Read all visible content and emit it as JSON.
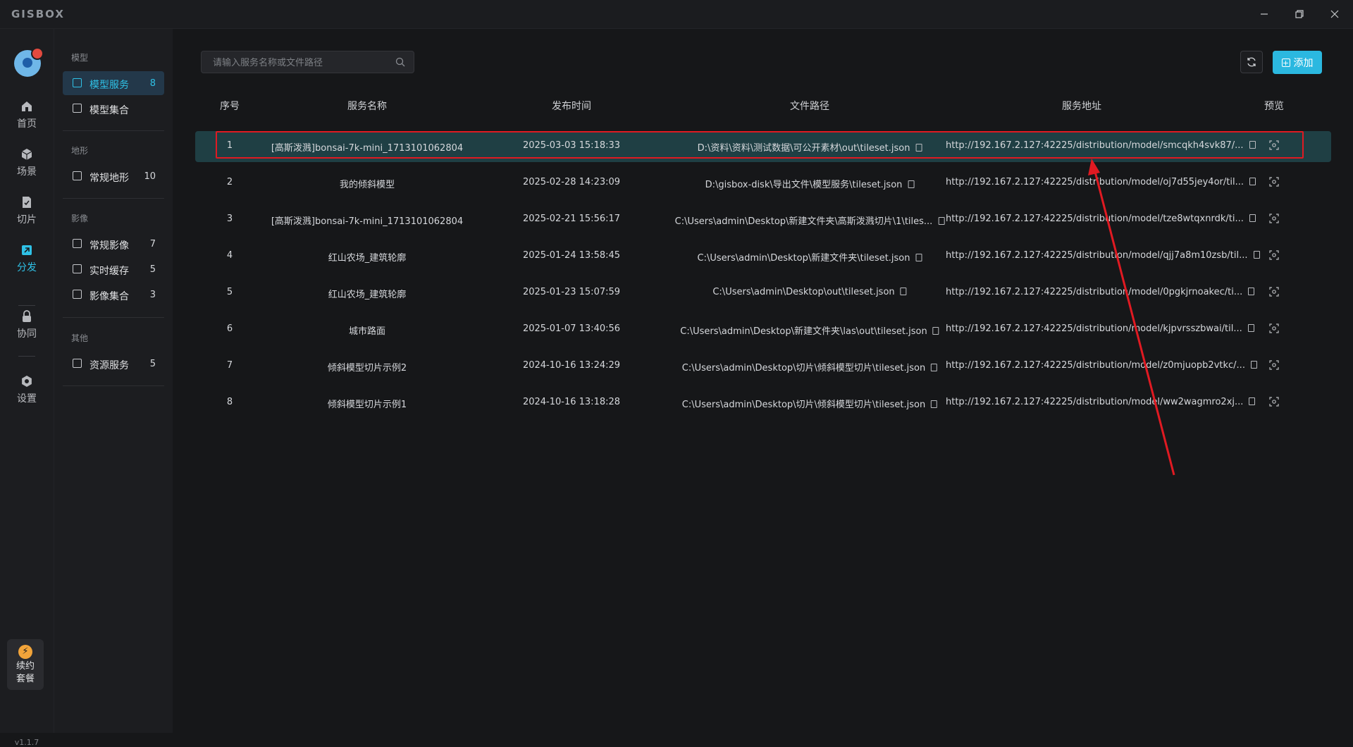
{
  "app": {
    "logo": "GISBOX"
  },
  "rail": {
    "items": [
      {
        "label": "首页",
        "icon": "home-icon"
      },
      {
        "label": "场景",
        "icon": "cube-icon"
      },
      {
        "label": "切片",
        "icon": "slice-icon"
      },
      {
        "label": "分发",
        "icon": "distribute-icon"
      },
      {
        "label": "协同",
        "icon": "lock-icon"
      },
      {
        "label": "设置",
        "icon": "gear-icon"
      }
    ],
    "renew": {
      "line1": "续约",
      "line2": "套餐"
    },
    "version": "v1.1.7"
  },
  "sidebar": {
    "groups": [
      {
        "title": "模型",
        "items": [
          {
            "label": "模型服务",
            "count": "8"
          },
          {
            "label": "模型集合",
            "count": ""
          }
        ]
      },
      {
        "title": "地形",
        "items": [
          {
            "label": "常规地形",
            "count": "10"
          }
        ]
      },
      {
        "title": "影像",
        "items": [
          {
            "label": "常规影像",
            "count": "7"
          },
          {
            "label": "实时缓存",
            "count": "5"
          },
          {
            "label": "影像集合",
            "count": "3"
          }
        ]
      },
      {
        "title": "其他",
        "items": [
          {
            "label": "资源服务",
            "count": "5"
          }
        ]
      }
    ]
  },
  "search": {
    "placeholder": "请输入服务名称或文件路径"
  },
  "toolbar": {
    "add_label": "添加"
  },
  "table": {
    "headers": [
      "序号",
      "服务名称",
      "发布时间",
      "文件路径",
      "服务地址",
      "预览"
    ],
    "rows": [
      {
        "no": "1",
        "name": "[高斯泼溅]bonsai-7k-mini_1713101062804",
        "time": "2025-03-03 15:18:33",
        "path": "D:\\资料\\资料\\测试数据\\可公开素材\\out\\tileset.json",
        "url": "http://192.167.2.127:42225/distribution/model/smcqkh4svk87/..."
      },
      {
        "no": "2",
        "name": "我的倾斜模型",
        "time": "2025-02-28 14:23:09",
        "path": "D:\\gisbox-disk\\导出文件\\模型服务\\tileset.json",
        "url": "http://192.167.2.127:42225/distribution/model/oj7d55jey4or/til..."
      },
      {
        "no": "3",
        "name": "[高斯泼溅]bonsai-7k-mini_1713101062804",
        "time": "2025-02-21 15:56:17",
        "path": "C:\\Users\\admin\\Desktop\\新建文件夹\\高斯泼溅切片\\1\\tiles...",
        "url": "http://192.167.2.127:42225/distribution/model/tze8wtqxnrdk/ti..."
      },
      {
        "no": "4",
        "name": "红山农场_建筑轮廓",
        "time": "2025-01-24 13:58:45",
        "path": "C:\\Users\\admin\\Desktop\\新建文件夹\\tileset.json",
        "url": "http://192.167.2.127:42225/distribution/model/qjj7a8m10zsb/til..."
      },
      {
        "no": "5",
        "name": "红山农场_建筑轮廓",
        "time": "2025-01-23 15:07:59",
        "path": "C:\\Users\\admin\\Desktop\\out\\tileset.json",
        "url": "http://192.167.2.127:42225/distribution/model/0pgkjrnoakec/ti..."
      },
      {
        "no": "6",
        "name": "城市路面",
        "time": "2025-01-07 13:40:56",
        "path": "C:\\Users\\admin\\Desktop\\新建文件夹\\las\\out\\tileset.json",
        "url": "http://192.167.2.127:42225/distribution/model/kjpvrsszbwai/til..."
      },
      {
        "no": "7",
        "name": "倾斜模型切片示例2",
        "time": "2024-10-16 13:24:29",
        "path": "C:\\Users\\admin\\Desktop\\切片\\倾斜模型切片\\tileset.json",
        "url": "http://192.167.2.127:42225/distribution/model/z0mjuopb2vtkc/..."
      },
      {
        "no": "8",
        "name": "倾斜模型切片示例1",
        "time": "2024-10-16 13:18:28",
        "path": "C:\\Users\\admin\\Desktop\\切片\\倾斜模型切片\\tileset.json",
        "url": "http://192.167.2.127:42225/distribution/model/ww2wagmro2xj..."
      }
    ]
  },
  "colors": {
    "accent": "#2fc1e6",
    "selected_row": "#1f3f44",
    "annotation": "#e01a22"
  }
}
